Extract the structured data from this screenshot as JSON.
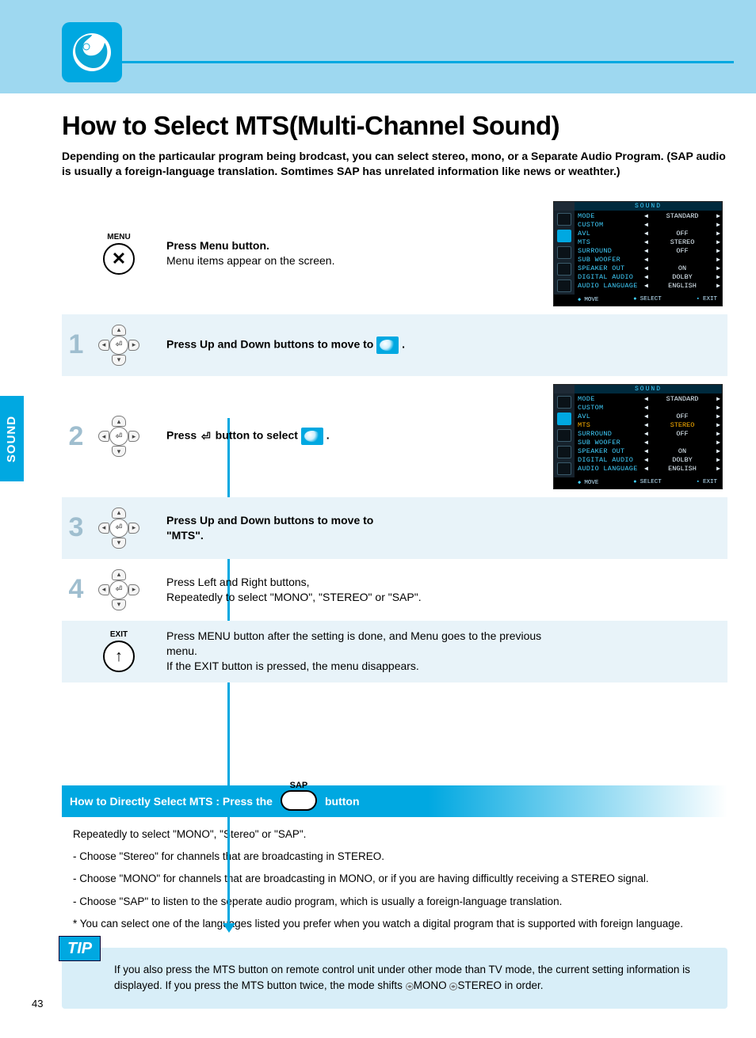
{
  "sideTab": "SOUND",
  "title": "How to Select MTS(Multi-Channel Sound)",
  "intro": "Depending on the particaular program being brodcast, you can select stereo, mono, or a Separate Audio Program. (SAP audio is usually a foreign-language translation. Somtimes SAP has unrelated information like news or weathter.)",
  "icons": {
    "menu": "MENU",
    "exit": "EXIT"
  },
  "steps": {
    "0": {
      "l1": "Press Menu button.",
      "l2": "Menu items appear on the screen."
    },
    "1": {
      "n": "1",
      "l1": "Press Up and Down buttons to move to"
    },
    "2": {
      "n": "2",
      "l1": "Press ",
      "l2": " button to select"
    },
    "3": {
      "n": "3",
      "l1": "Press Up and Down buttons to move to",
      "l2": "\"MTS\"."
    },
    "4": {
      "n": "4",
      "l1": "Press Left and Right buttons,",
      "l2": "Repeatedly to select \"MONO\", \"STEREO\" or \"SAP\"."
    },
    "5": {
      "l1": "Press MENU button after the setting is done, and Menu goes to the previous menu.",
      "l2": "If the EXIT button is pressed, the menu disappears."
    }
  },
  "direct": {
    "t1": "How to Directly Select MTS : Press the",
    "sap": "SAP",
    "t2": "button"
  },
  "notes": {
    "0": "Repeatedly to select \"MONO\", \"Stereo\" or \"SAP\".",
    "1": "- Choose \"Stereo\" for channels that are broadcasting in STEREO.",
    "2": "- Choose \"MONO\" for channels that are broadcasting in MONO, or if you are having difficultly receiving a STEREO signal.",
    "3": "- Choose \"SAP\" to listen to the seperate audio program, which is usually a foreign-language translation.",
    "4": "* You can select one of the languages listed you prefer when you watch a digital program that is supported with foreign language."
  },
  "tip": {
    "label": "TIP",
    "t1": "If you also press the MTS button on remote control unit under other mode than TV mode, the current setting information is displayed. If you press the MTS button twice, the mode shifts ",
    "mono": "MONO ",
    "stereo": "STEREO",
    "t2": " in order."
  },
  "osd": {
    "title": "SOUND",
    "rows": [
      {
        "k": "MODE",
        "v": "STANDARD"
      },
      {
        "k": "CUSTOM",
        "v": ""
      },
      {
        "k": "AVL",
        "v": "OFF"
      },
      {
        "k": "MTS",
        "v": "STEREO"
      },
      {
        "k": "SURROUND",
        "v": "OFF"
      },
      {
        "k": "SUB WOOFER",
        "v": ""
      },
      {
        "k": "SPEAKER OUT",
        "v": "ON"
      },
      {
        "k": "DIGITAL AUDIO",
        "v": "DOLBY"
      },
      {
        "k": "AUDIO LANGUAGE",
        "v": "ENGLISH"
      }
    ],
    "footer": [
      "MOVE",
      "SELECT",
      "EXIT"
    ]
  },
  "pageNumber": "43"
}
